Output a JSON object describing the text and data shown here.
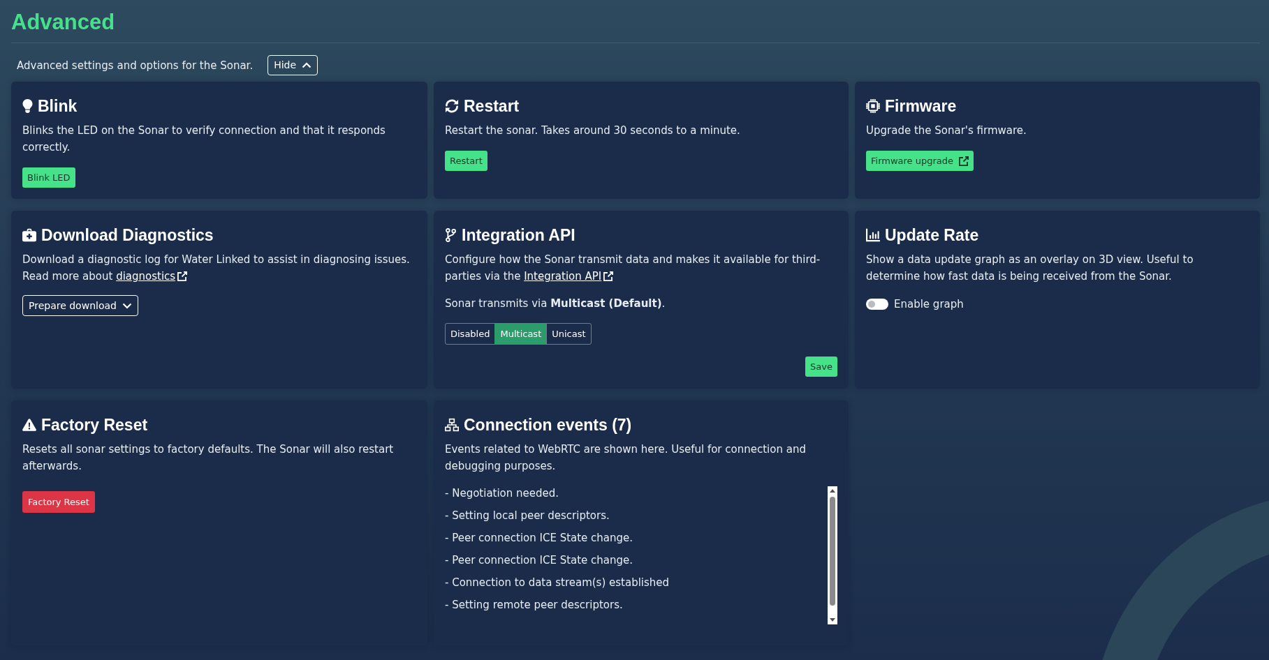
{
  "page": {
    "title": "Advanced",
    "description": "Advanced settings and options for the Sonar.",
    "toggle_button": {
      "label": "Hide",
      "expanded": true
    }
  },
  "blink": {
    "title": "Blink",
    "description": "Blinks the LED on the Sonar to verify connection and that it responds correctly.",
    "button": "Blink LED"
  },
  "restart": {
    "title": "Restart",
    "description": "Restart the sonar. Takes around 30 seconds to a minute.",
    "button": "Restart"
  },
  "firmware": {
    "title": "Firmware",
    "description": "Upgrade the Sonar's firmware.",
    "button": "Firmware upgrade"
  },
  "diagnostics": {
    "title": "Download Diagnostics",
    "description": "Download a diagnostic log for Water Linked to assist in diagnosing issues. Read more about",
    "link": "diagnostics",
    "button": "Prepare download"
  },
  "integration_api": {
    "title": "Integration API",
    "description": "Configure how the Sonar transmit data and makes it available for third-parties via the",
    "link": "Integration API",
    "status": "Sonar transmits via **Multicast (Default)**.",
    "modes": [
      {
        "label": "Disabled",
        "selected": false
      },
      {
        "label": "Multicast",
        "selected": true
      },
      {
        "label": "Unicast",
        "selected": false
      }
    ],
    "button": "Save"
  },
  "update_rate": {
    "title": "Update Rate",
    "description": "Show a data update graph as an overlay on 3D view. Useful to determine how fast data is being received from the Sonar.",
    "toggle": {
      "label": "Enable graph",
      "on": false
    }
  },
  "factory_reset": {
    "title": "Factory Reset",
    "description": "Resets all sonar settings to factory defaults. The Sonar will also restart afterwards.",
    "button": "Factory Reset"
  },
  "connection_events": {
    "title": "Connection events (7)",
    "description": "Events related to WebRTC are shown here. Useful for connection and debugging purposes.",
    "events": [
      "- Negotiation needed.",
      "- Setting local peer descriptors.",
      "- Peer connection ICE State change.",
      "- Peer connection ICE State change.",
      "- Connection to data stream(s) established",
      "- Setting remote peer descriptors."
    ]
  }
}
